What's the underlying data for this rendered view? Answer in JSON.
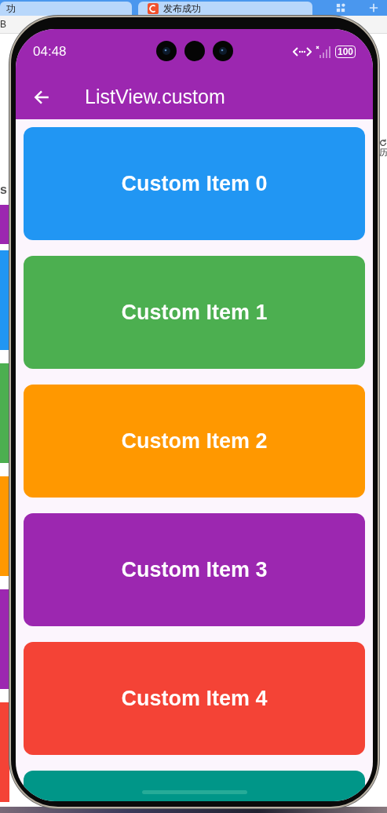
{
  "browser": {
    "tabs": [
      {
        "title": "功",
        "kind": "plain"
      },
      {
        "title": "发布成功",
        "kind": "site"
      }
    ],
    "toolbar_fragment": "B",
    "heading_fragment": "s",
    "history_fragment": "历",
    "strip_blocks": [
      {
        "color": "#9c27b0"
      },
      {
        "color": "#2196f3"
      },
      {
        "color": "#4caf50"
      },
      {
        "color": "#ff9800"
      },
      {
        "color": "#9c27b0"
      },
      {
        "color": "#f44336"
      }
    ]
  },
  "phone": {
    "status_bar": {
      "time": "04:48",
      "battery": "100"
    },
    "app_bar": {
      "title": "ListView.custom"
    },
    "items": [
      {
        "label": "Custom Item 0",
        "color": "#2196f3"
      },
      {
        "label": "Custom Item 1",
        "color": "#4caf50"
      },
      {
        "label": "Custom Item 2",
        "color": "#ff9800"
      },
      {
        "label": "Custom Item 3",
        "color": "#9c27b0"
      },
      {
        "label": "Custom Item 4",
        "color": "#f44336"
      },
      {
        "color": "#009688"
      }
    ]
  }
}
